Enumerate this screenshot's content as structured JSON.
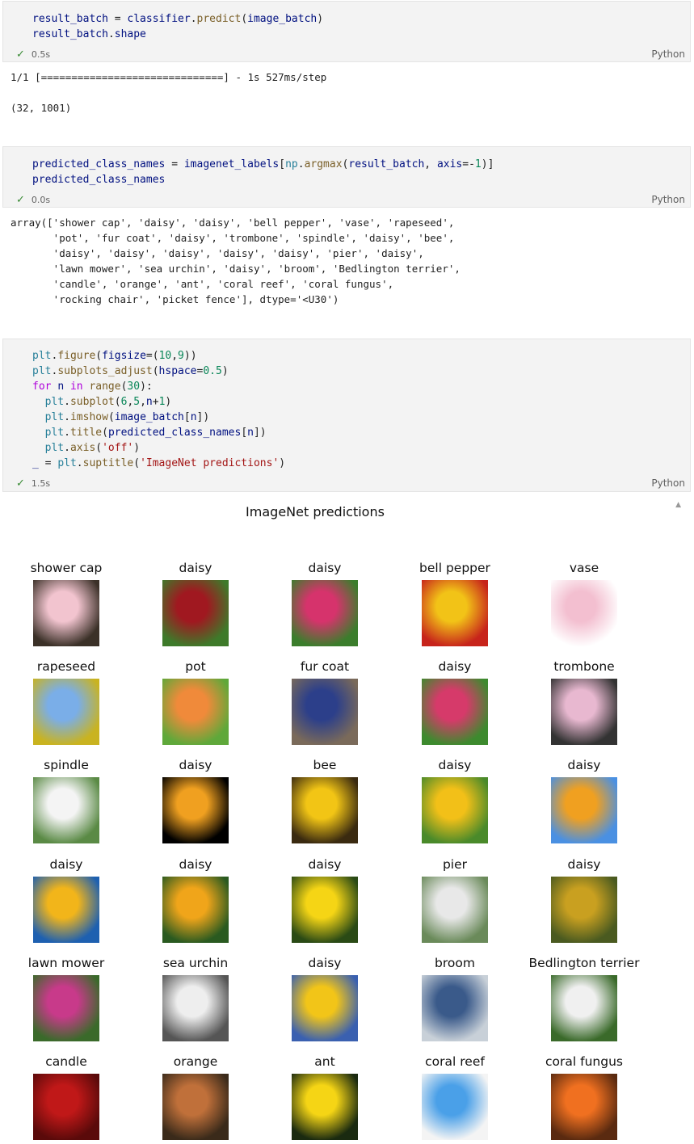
{
  "cells": [
    {
      "code": [
        [
          [
            "var",
            "result_batch"
          ],
          [
            "plain",
            " = "
          ],
          [
            "var",
            "classifier"
          ],
          [
            "plain",
            "."
          ],
          [
            "fn",
            "predict"
          ],
          [
            "plain",
            "("
          ],
          [
            "var",
            "image_batch"
          ],
          [
            "plain",
            ")"
          ]
        ],
        [
          [
            "var",
            "result_batch"
          ],
          [
            "plain",
            "."
          ],
          [
            "var",
            "shape"
          ]
        ]
      ],
      "time": "0.5s",
      "lang": "Python",
      "output": [
        "1/1 [==============================] - 1s 527ms/step",
        "",
        "(32, 1001)"
      ]
    },
    {
      "code": [
        [
          [
            "var",
            "predicted_class_names"
          ],
          [
            "plain",
            " = "
          ],
          [
            "var",
            "imagenet_labels"
          ],
          [
            "plain",
            "["
          ],
          [
            "blt",
            "np"
          ],
          [
            "plain",
            "."
          ],
          [
            "fn",
            "argmax"
          ],
          [
            "plain",
            "("
          ],
          [
            "var",
            "result_batch"
          ],
          [
            "plain",
            ", "
          ],
          [
            "var",
            "axis"
          ],
          [
            "plain",
            "=-"
          ],
          [
            "num",
            "1"
          ],
          [
            "plain",
            ")]"
          ]
        ],
        [
          [
            "var",
            "predicted_class_names"
          ]
        ]
      ],
      "time": "0.0s",
      "lang": "Python",
      "output": [
        "array(['shower cap', 'daisy', 'daisy', 'bell pepper', 'vase', 'rapeseed',",
        "       'pot', 'fur coat', 'daisy', 'trombone', 'spindle', 'daisy', 'bee',",
        "       'daisy', 'daisy', 'daisy', 'daisy', 'daisy', 'pier', 'daisy',",
        "       'lawn mower', 'sea urchin', 'daisy', 'broom', 'Bedlington terrier',",
        "       'candle', 'orange', 'ant', 'coral reef', 'coral fungus',",
        "       'rocking chair', 'picket fence'], dtype='<U30')"
      ]
    },
    {
      "code": [
        [
          [
            "blt",
            "plt"
          ],
          [
            "plain",
            "."
          ],
          [
            "fn",
            "figure"
          ],
          [
            "plain",
            "("
          ],
          [
            "var",
            "figsize"
          ],
          [
            "plain",
            "=("
          ],
          [
            "num",
            "10"
          ],
          [
            "plain",
            ","
          ],
          [
            "num",
            "9"
          ],
          [
            "plain",
            "))"
          ]
        ],
        [
          [
            "blt",
            "plt"
          ],
          [
            "plain",
            "."
          ],
          [
            "fn",
            "subplots_adjust"
          ],
          [
            "plain",
            "("
          ],
          [
            "var",
            "hspace"
          ],
          [
            "plain",
            "="
          ],
          [
            "num",
            "0.5"
          ],
          [
            "plain",
            ")"
          ]
        ],
        [
          [
            "kw",
            "for"
          ],
          [
            "plain",
            " "
          ],
          [
            "var",
            "n"
          ],
          [
            "plain",
            " "
          ],
          [
            "kw",
            "in"
          ],
          [
            "plain",
            " "
          ],
          [
            "fn",
            "range"
          ],
          [
            "plain",
            "("
          ],
          [
            "num",
            "30"
          ],
          [
            "plain",
            "):"
          ]
        ],
        [
          [
            "plain",
            "  "
          ],
          [
            "blt",
            "plt"
          ],
          [
            "plain",
            "."
          ],
          [
            "fn",
            "subplot"
          ],
          [
            "plain",
            "("
          ],
          [
            "num",
            "6"
          ],
          [
            "plain",
            ","
          ],
          [
            "num",
            "5"
          ],
          [
            "plain",
            ","
          ],
          [
            "var",
            "n"
          ],
          [
            "plain",
            "+"
          ],
          [
            "num",
            "1"
          ],
          [
            "plain",
            ")"
          ]
        ],
        [
          [
            "plain",
            "  "
          ],
          [
            "blt",
            "plt"
          ],
          [
            "plain",
            "."
          ],
          [
            "fn",
            "imshow"
          ],
          [
            "plain",
            "("
          ],
          [
            "var",
            "image_batch"
          ],
          [
            "plain",
            "["
          ],
          [
            "var",
            "n"
          ],
          [
            "plain",
            "])"
          ]
        ],
        [
          [
            "plain",
            "  "
          ],
          [
            "blt",
            "plt"
          ],
          [
            "plain",
            "."
          ],
          [
            "fn",
            "title"
          ],
          [
            "plain",
            "("
          ],
          [
            "var",
            "predicted_class_names"
          ],
          [
            "plain",
            "["
          ],
          [
            "var",
            "n"
          ],
          [
            "plain",
            "])"
          ]
        ],
        [
          [
            "plain",
            "  "
          ],
          [
            "blt",
            "plt"
          ],
          [
            "plain",
            "."
          ],
          [
            "fn",
            "axis"
          ],
          [
            "plain",
            "("
          ],
          [
            "str",
            "'off'"
          ],
          [
            "plain",
            ")"
          ]
        ],
        [
          [
            "var",
            "_"
          ],
          [
            "plain",
            " = "
          ],
          [
            "blt",
            "plt"
          ],
          [
            "plain",
            "."
          ],
          [
            "fn",
            "suptitle"
          ],
          [
            "plain",
            "("
          ],
          [
            "str",
            "'ImageNet predictions'"
          ],
          [
            "plain",
            ")"
          ]
        ]
      ],
      "time": "1.5s",
      "lang": "Python",
      "output": []
    }
  ],
  "figure": {
    "suptitle": "ImageNet predictions",
    "tiles": [
      {
        "label": "shower cap",
        "colors": [
          "#f2c4cf",
          "#3b3128"
        ]
      },
      {
        "label": "daisy",
        "colors": [
          "#a01820",
          "#3e7a2a"
        ]
      },
      {
        "label": "daisy",
        "colors": [
          "#d6336c",
          "#3b7d2c"
        ]
      },
      {
        "label": "bell pepper",
        "colors": [
          "#f2c317",
          "#c7241b"
        ]
      },
      {
        "label": "vase",
        "colors": [
          "#f3bfd0",
          "#ffffff"
        ]
      },
      {
        "label": "rapeseed",
        "colors": [
          "#7aaee8",
          "#c9b320"
        ]
      },
      {
        "label": "pot",
        "colors": [
          "#f08a3a",
          "#5fa83a"
        ]
      },
      {
        "label": "fur coat",
        "colors": [
          "#2c3f8a",
          "#7a6a5a"
        ]
      },
      {
        "label": "daisy",
        "colors": [
          "#d63a6a",
          "#3d8a2e"
        ]
      },
      {
        "label": "trombone",
        "colors": [
          "#e8b8d0",
          "#333333"
        ]
      },
      {
        "label": "spindle",
        "colors": [
          "#f4f4f4",
          "#5a8a45"
        ]
      },
      {
        "label": "daisy",
        "colors": [
          "#f0a020",
          "#000000"
        ]
      },
      {
        "label": "bee",
        "colors": [
          "#f2c515",
          "#3a2a10"
        ]
      },
      {
        "label": "daisy",
        "colors": [
          "#f2c018",
          "#4a8a2a"
        ]
      },
      {
        "label": "daisy",
        "colors": [
          "#f0a020",
          "#4a90e2"
        ]
      },
      {
        "label": "daisy",
        "colors": [
          "#f2b51a",
          "#1e60b0"
        ]
      },
      {
        "label": "daisy",
        "colors": [
          "#f0a51a",
          "#2a5a20"
        ]
      },
      {
        "label": "daisy",
        "colors": [
          "#f5d515",
          "#2a4a15"
        ]
      },
      {
        "label": "pier",
        "colors": [
          "#e8e8e8",
          "#6a8a5a"
        ]
      },
      {
        "label": "daisy",
        "colors": [
          "#c9a020",
          "#4a5a20"
        ]
      },
      {
        "label": "lawn mower",
        "colors": [
          "#c83a8a",
          "#3a6a2a"
        ]
      },
      {
        "label": "sea urchin",
        "colors": [
          "#eeeeee",
          "#555555"
        ]
      },
      {
        "label": "daisy",
        "colors": [
          "#f2c518",
          "#3a60b0"
        ]
      },
      {
        "label": "broom",
        "colors": [
          "#3a5a8a",
          "#c8d0d8"
        ]
      },
      {
        "label": "Bedlington terrier",
        "colors": [
          "#f0f0f0",
          "#3a6a2a"
        ]
      },
      {
        "label": "candle",
        "colors": [
          "#c01818",
          "#5a0a0a"
        ]
      },
      {
        "label": "orange",
        "colors": [
          "#c0703a",
          "#3a2a1a"
        ]
      },
      {
        "label": "ant",
        "colors": [
          "#f5d515",
          "#1a2a10"
        ]
      },
      {
        "label": "coral reef",
        "colors": [
          "#4aa0e8",
          "#f4f4f4"
        ]
      },
      {
        "label": "coral fungus",
        "colors": [
          "#f07020",
          "#5a2a10"
        ]
      }
    ]
  }
}
